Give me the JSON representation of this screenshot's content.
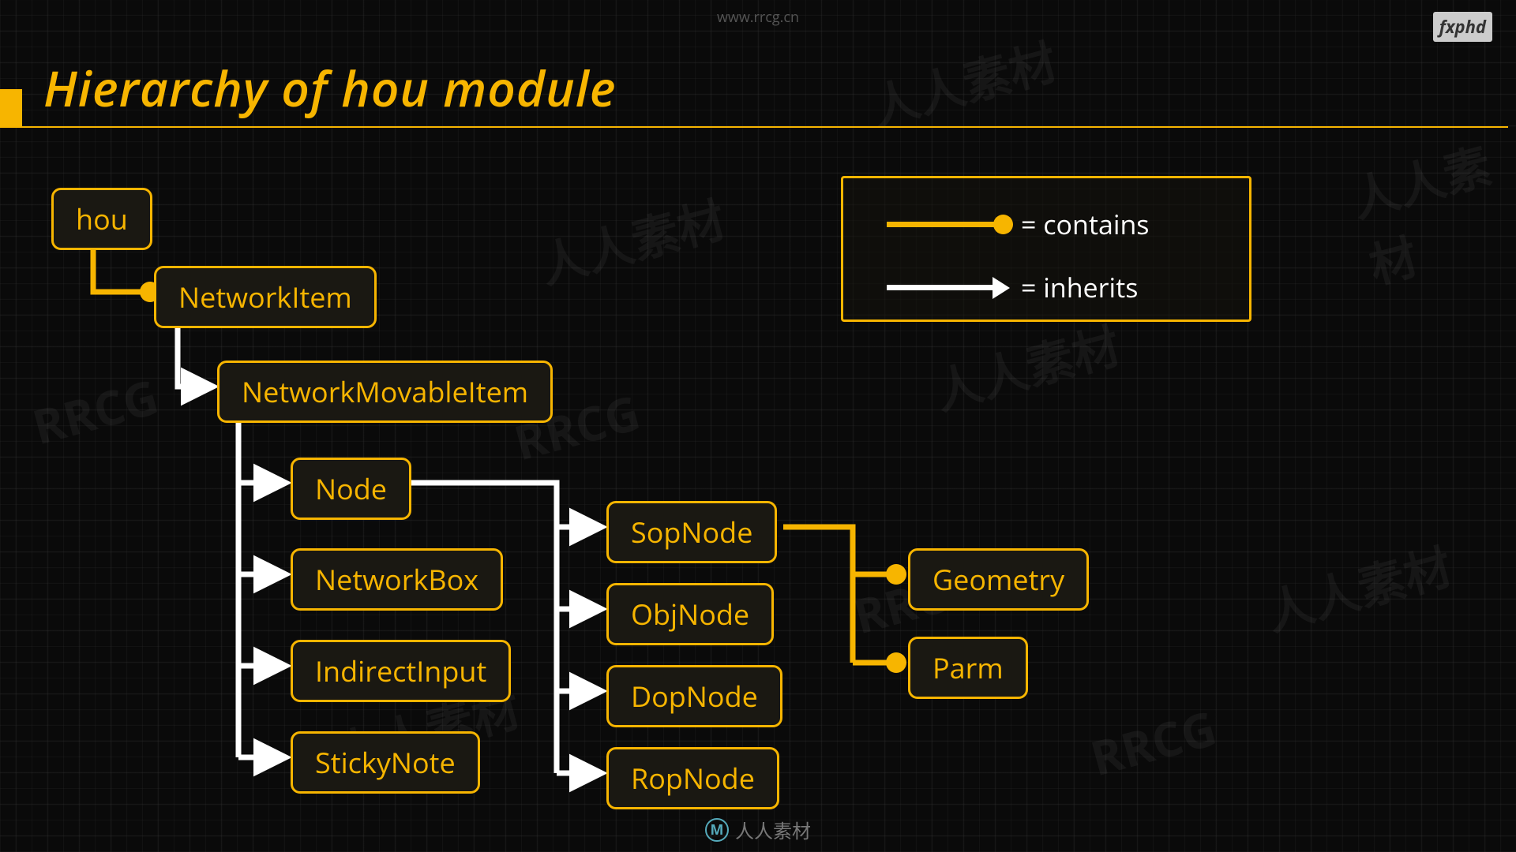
{
  "header": {
    "url": "www.rrcg.cn",
    "logo": "fxphd"
  },
  "title": "Hierarchy of hou module",
  "legend": {
    "contains": "=  contains",
    "inherits": "=  inherits"
  },
  "nodes": {
    "hou": "hou",
    "networkitem": "NetworkItem",
    "networkmovableitem": "NetworkMovableItem",
    "node": "Node",
    "networkbox": "NetworkBox",
    "indirectinput": "IndirectInput",
    "stickynote": "StickyNote",
    "sopnode": "SopNode",
    "objnode": "ObjNode",
    "dopnode": "DopNode",
    "ropnode": "RopNode",
    "geometry": "Geometry",
    "parm": "Parm"
  },
  "footer": {
    "text": "人人素材"
  },
  "chart_data": {
    "type": "hierarchy",
    "title": "Hierarchy of hou module",
    "edge_types": {
      "contains": "yellow-dot",
      "inherits": "white-arrow"
    },
    "nodes": [
      "hou",
      "NetworkItem",
      "NetworkMovableItem",
      "Node",
      "NetworkBox",
      "IndirectInput",
      "StickyNote",
      "SopNode",
      "ObjNode",
      "DopNode",
      "RopNode",
      "Geometry",
      "Parm"
    ],
    "edges": [
      {
        "from": "hou",
        "to": "NetworkItem",
        "type": "contains"
      },
      {
        "from": "NetworkItem",
        "to": "NetworkMovableItem",
        "type": "inherits"
      },
      {
        "from": "NetworkMovableItem",
        "to": "Node",
        "type": "inherits"
      },
      {
        "from": "NetworkMovableItem",
        "to": "NetworkBox",
        "type": "inherits"
      },
      {
        "from": "NetworkMovableItem",
        "to": "IndirectInput",
        "type": "inherits"
      },
      {
        "from": "NetworkMovableItem",
        "to": "StickyNote",
        "type": "inherits"
      },
      {
        "from": "Node",
        "to": "SopNode",
        "type": "inherits"
      },
      {
        "from": "Node",
        "to": "ObjNode",
        "type": "inherits"
      },
      {
        "from": "Node",
        "to": "DopNode",
        "type": "inherits"
      },
      {
        "from": "Node",
        "to": "RopNode",
        "type": "inherits"
      },
      {
        "from": "SopNode",
        "to": "Geometry",
        "type": "contains"
      },
      {
        "from": "SopNode",
        "to": "Parm",
        "type": "contains"
      }
    ]
  }
}
